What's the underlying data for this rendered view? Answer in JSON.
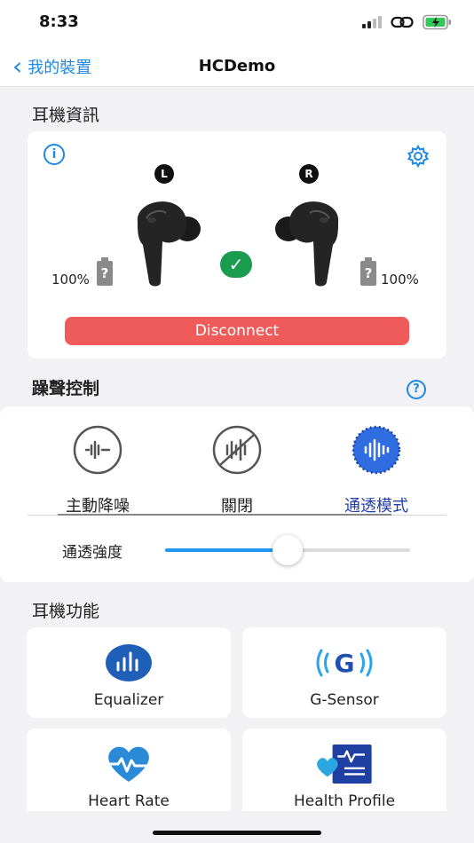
{
  "status_bar": {
    "time": "8:33"
  },
  "nav": {
    "back_label": "我的裝置",
    "title": "HCDemo"
  },
  "earbud_info": {
    "section_title": "耳機資訊",
    "left_badge": "L",
    "right_badge": "R",
    "left_battery": "100%",
    "right_battery": "100%",
    "battery_unknown_glyph": "?",
    "disconnect_label": "Disconnect"
  },
  "noise_control": {
    "section_title": "躁聲控制",
    "modes": [
      {
        "label": "主動降噪",
        "active": false
      },
      {
        "label": "關閉",
        "active": false
      },
      {
        "label": "通透模式",
        "active": true
      }
    ],
    "slider_label": "通透強度",
    "slider_value": 0.5
  },
  "features": {
    "section_title": "耳機功能",
    "items": [
      {
        "label": "Equalizer",
        "icon": "equalizer-icon"
      },
      {
        "label": "G-Sensor",
        "icon": "g-sensor-icon"
      },
      {
        "label": "Heart Rate",
        "icon": "heart-rate-icon"
      },
      {
        "label": "Health Profile",
        "icon": "health-profile-icon"
      }
    ]
  },
  "colors": {
    "accent": "#1e88e5",
    "disconnect": "#ef5b5b",
    "connected": "#1a9c4e",
    "active_mode": "#1e3fae"
  }
}
